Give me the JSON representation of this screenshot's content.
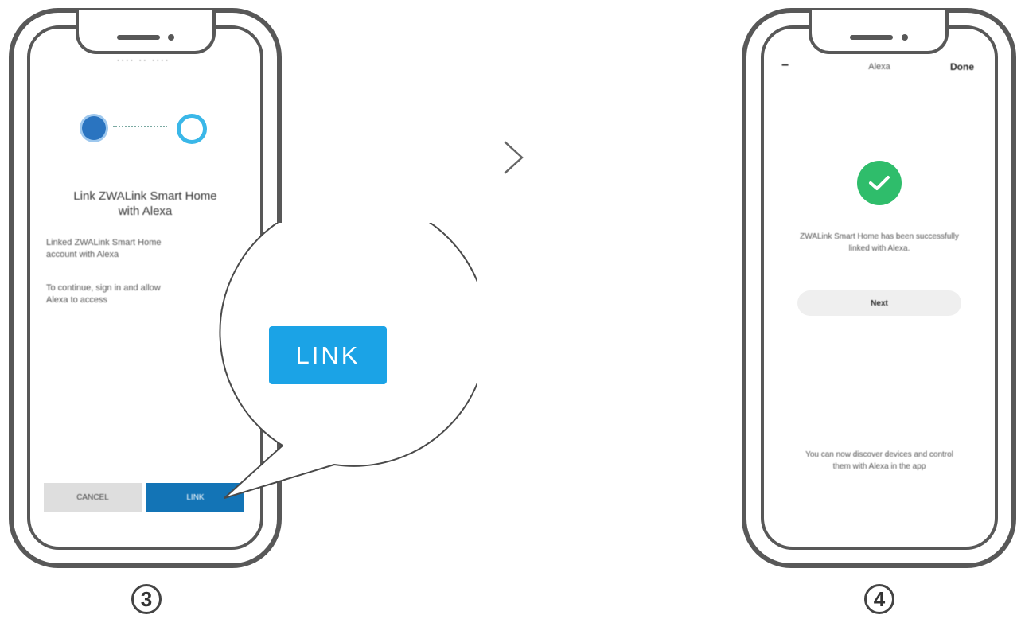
{
  "steps": {
    "left": "3",
    "right": "4"
  },
  "left_phone": {
    "header_text": "···· ·· ····",
    "heading_line1": "Link ZWALink Smart Home",
    "heading_line2": "with Alexa",
    "para1_line1": "Linked ZWALink Smart Home",
    "para1_line2": "account with Alexa",
    "para2_line1": "To continue, sign in and allow",
    "para2_line2": "Alexa to access",
    "cancel_label": "CANCEL",
    "link_label": "LINK"
  },
  "callout": {
    "link_label": "LINK"
  },
  "right_phone": {
    "back_glyph": "−",
    "header_title": "Alexa",
    "header_right": "Done",
    "success_line1": "ZWALink Smart Home has been successfully",
    "success_line2": "linked with Alexa.",
    "next_label": "Next",
    "footer_line1": "You can now discover devices and control",
    "footer_line2": "them with Alexa in the app"
  },
  "colors": {
    "frame": "#585858",
    "link_blue": "#1ba3e6",
    "dark_blue": "#1374b6",
    "success_green": "#2fbd6b"
  }
}
